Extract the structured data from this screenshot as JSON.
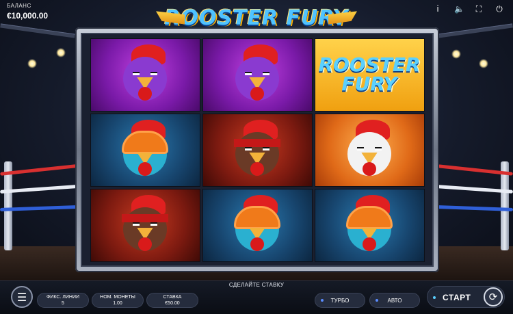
{
  "balance": {
    "label": "БАЛАНС",
    "value": "€10,000.00"
  },
  "logo": {
    "text": "ROOSTER FURY"
  },
  "top_icons": [
    {
      "name": "info-icon",
      "glyph": "i"
    },
    {
      "name": "sound-icon",
      "glyph": "🔈"
    },
    {
      "name": "fullscreen-icon",
      "glyph": "⛶"
    },
    {
      "name": "power-icon",
      "glyph": "⏻"
    }
  ],
  "reels": [
    [
      "purple-rooster",
      "purple-rooster",
      "rooster-fury-logo"
    ],
    [
      "blue-helmet-rooster",
      "red-bandana-rooster",
      "white-fighter-rooster"
    ],
    [
      "red-bandana-rooster",
      "blue-helmet-rooster",
      "blue-helmet-rooster"
    ]
  ],
  "logo_tile": {
    "line1": "ROOSTER",
    "line2": "FURY"
  },
  "prompt": "СДЕЛАЙТЕ СТАВКУ",
  "controls": {
    "lines": {
      "label": "ФИКС. ЛИНИИ",
      "value": "5"
    },
    "coin": {
      "label": "НОМ. МОНЕТЫ",
      "value": "1.00"
    },
    "bet": {
      "label": "СТАВКА",
      "value": "€50.00"
    },
    "turbo": "ТУРБО",
    "auto": "АВТО",
    "start": "СТАРТ"
  }
}
